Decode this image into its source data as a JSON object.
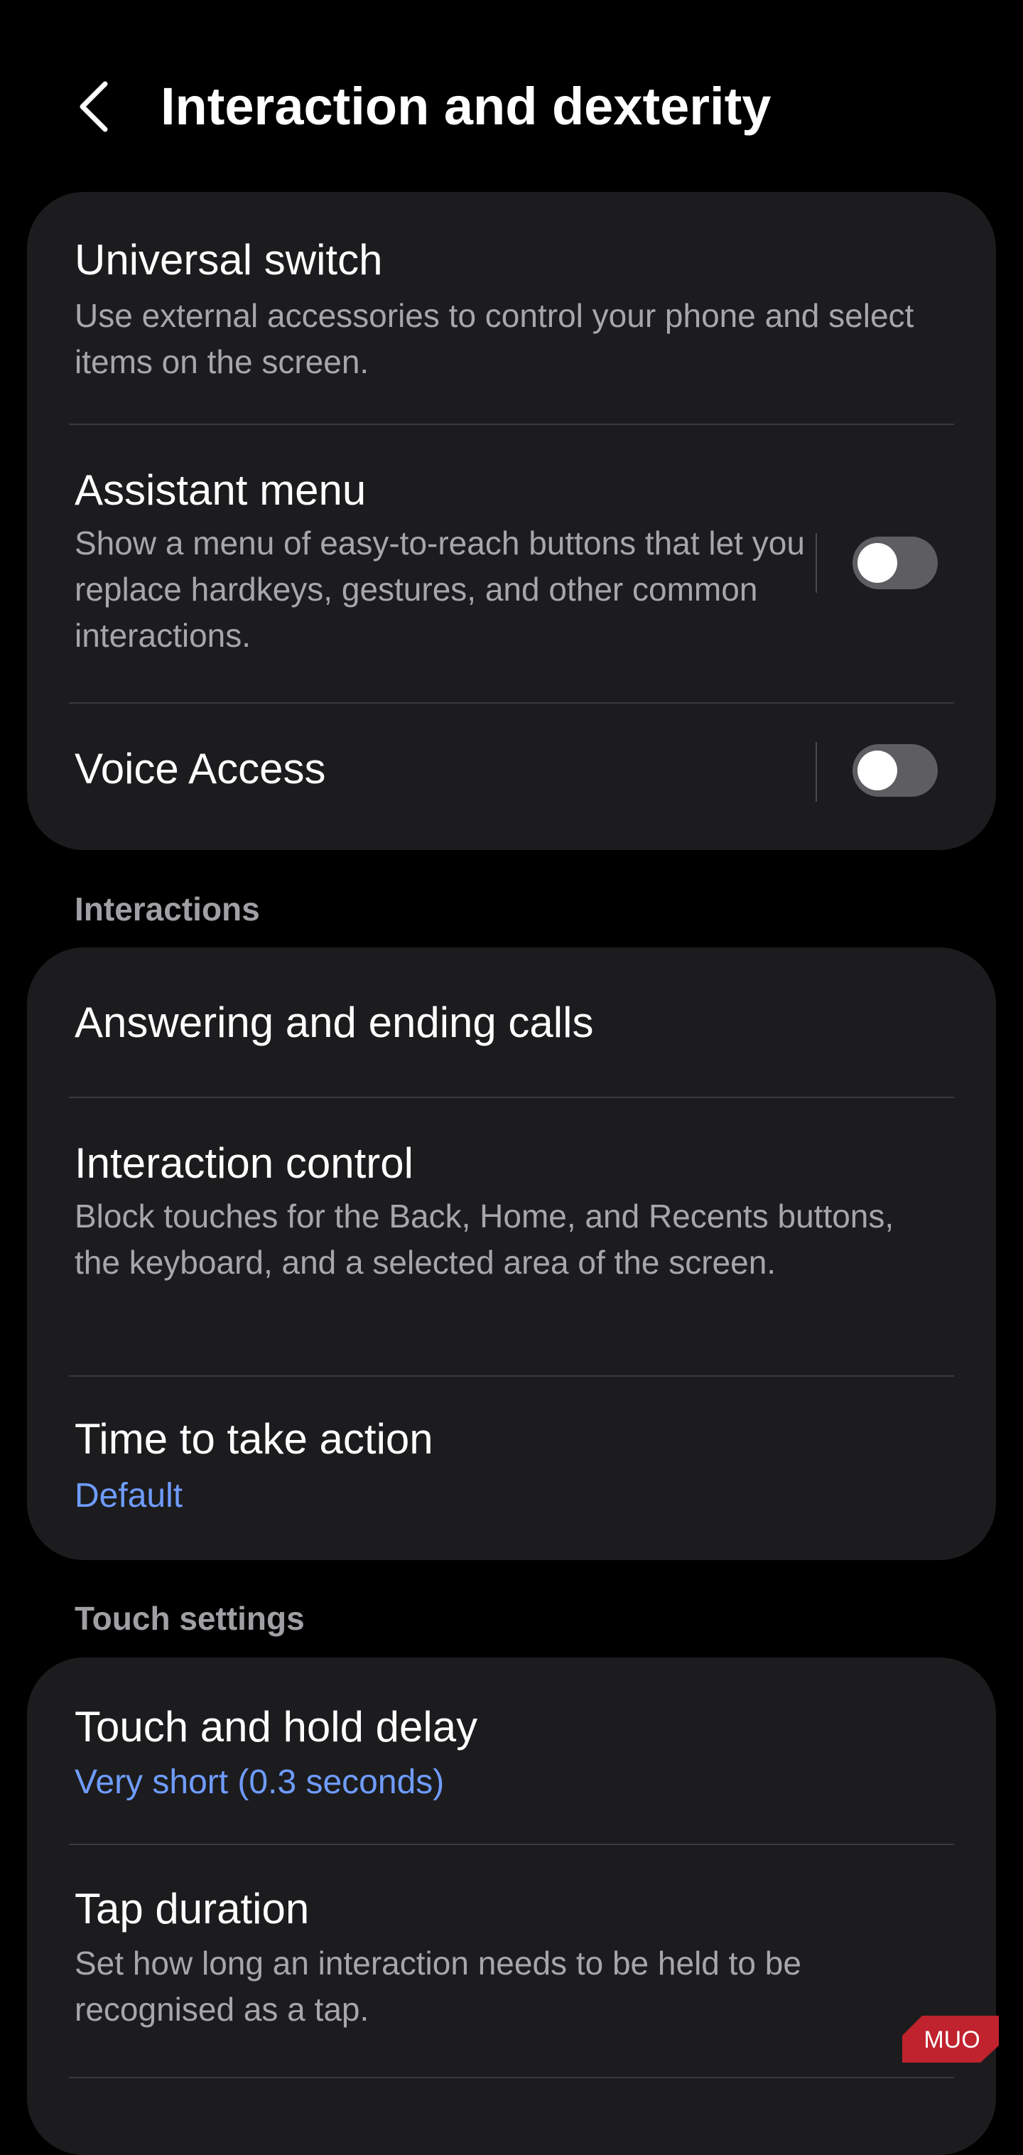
{
  "header": {
    "title": "Interaction and dexterity",
    "back_icon": "chevron-left-icon"
  },
  "top_group": {
    "universal_switch": {
      "title": "Universal switch",
      "description": "Use external accessories to control your phone and select items on the screen."
    },
    "assistant_menu": {
      "title": "Assistant menu",
      "description": "Show a menu of easy-to-reach buttons that let you replace hardkeys, gestures, and other common interactions.",
      "enabled": false
    },
    "voice_access": {
      "title": "Voice Access",
      "enabled": false
    }
  },
  "interactions": {
    "label": "Interactions",
    "answering_calls": {
      "title": "Answering and ending calls"
    },
    "interaction_control": {
      "title": "Interaction control",
      "description": "Block touches for the Back, Home, and Recents buttons, the keyboard, and a selected area of the screen."
    },
    "time_to_take_action": {
      "title": "Time to take action",
      "value": "Default"
    }
  },
  "touch_settings": {
    "label": "Touch settings",
    "touch_and_hold_delay": {
      "title": "Touch and hold delay",
      "value": "Very short (0.3 seconds)"
    },
    "tap_duration": {
      "title": "Tap duration",
      "description": "Set how long an interaction needs to be held to be recognised as a tap."
    }
  },
  "watermark": {
    "text": "MUO"
  },
  "colors": {
    "background": "#000000",
    "card": "#1c1c1e",
    "accent": "#6f9cff",
    "secondary_text": "#a7a7ab",
    "toggle_off": "#5e5e62",
    "watermark": "#c0222e"
  }
}
